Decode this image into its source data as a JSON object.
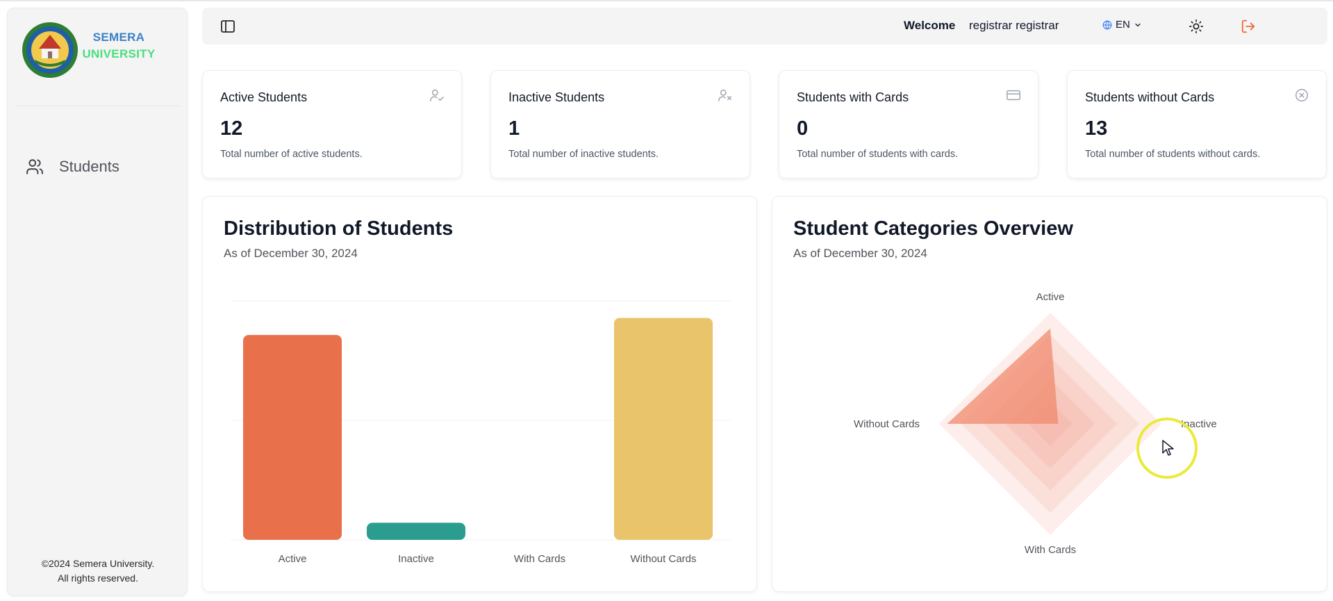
{
  "sidebar": {
    "brand_line1": "SEMERA",
    "brand_line2": "UNIVERSITY",
    "nav_items": [
      {
        "label": "Students",
        "icon": "users-icon"
      }
    ],
    "footer_line1": "©2024 Semera University.",
    "footer_line2": "All rights reserved."
  },
  "header": {
    "welcome_label": "Welcome",
    "username": "registrar registrar",
    "language": "EN"
  },
  "stat_cards": [
    {
      "title": "Active Students",
      "value": "12",
      "description": "Total number of active students.",
      "icon": "user-check-icon"
    },
    {
      "title": "Inactive Students",
      "value": "1",
      "description": "Total number of inactive students.",
      "icon": "user-x-icon"
    },
    {
      "title": "Students with Cards",
      "value": "0",
      "description": "Total number of students with cards.",
      "icon": "credit-card-icon"
    },
    {
      "title": "Students without Cards",
      "value": "13",
      "description": "Total number of students without cards.",
      "icon": "circle-x-icon"
    }
  ],
  "bar_panel": {
    "title": "Distribution of Students",
    "subtitle": "As of December 30, 2024"
  },
  "radar_panel": {
    "title": "Student Categories Overview",
    "subtitle": "As of December 30, 2024"
  },
  "colors": {
    "active": "#e8704a",
    "inactive": "#2a9d8f",
    "with_cards": "#e9c46a",
    "without_cards": "#e9c46a",
    "radar_fill": "#f08a6e",
    "brand_blue": "#3b82c4",
    "brand_green": "#4ade80",
    "logout": "#ef6a3a"
  },
  "chart_data": [
    {
      "type": "bar",
      "categories": [
        "Active",
        "Inactive",
        "With Cards",
        "Without Cards"
      ],
      "values": [
        12,
        1,
        0,
        13
      ],
      "ylim": [
        0,
        14
      ],
      "grid": true
    },
    {
      "type": "radar",
      "categories": [
        "Active",
        "Inactive",
        "With Cards",
        "Without Cards"
      ],
      "values": [
        12,
        1,
        0,
        13
      ],
      "rmax": 14
    }
  ]
}
